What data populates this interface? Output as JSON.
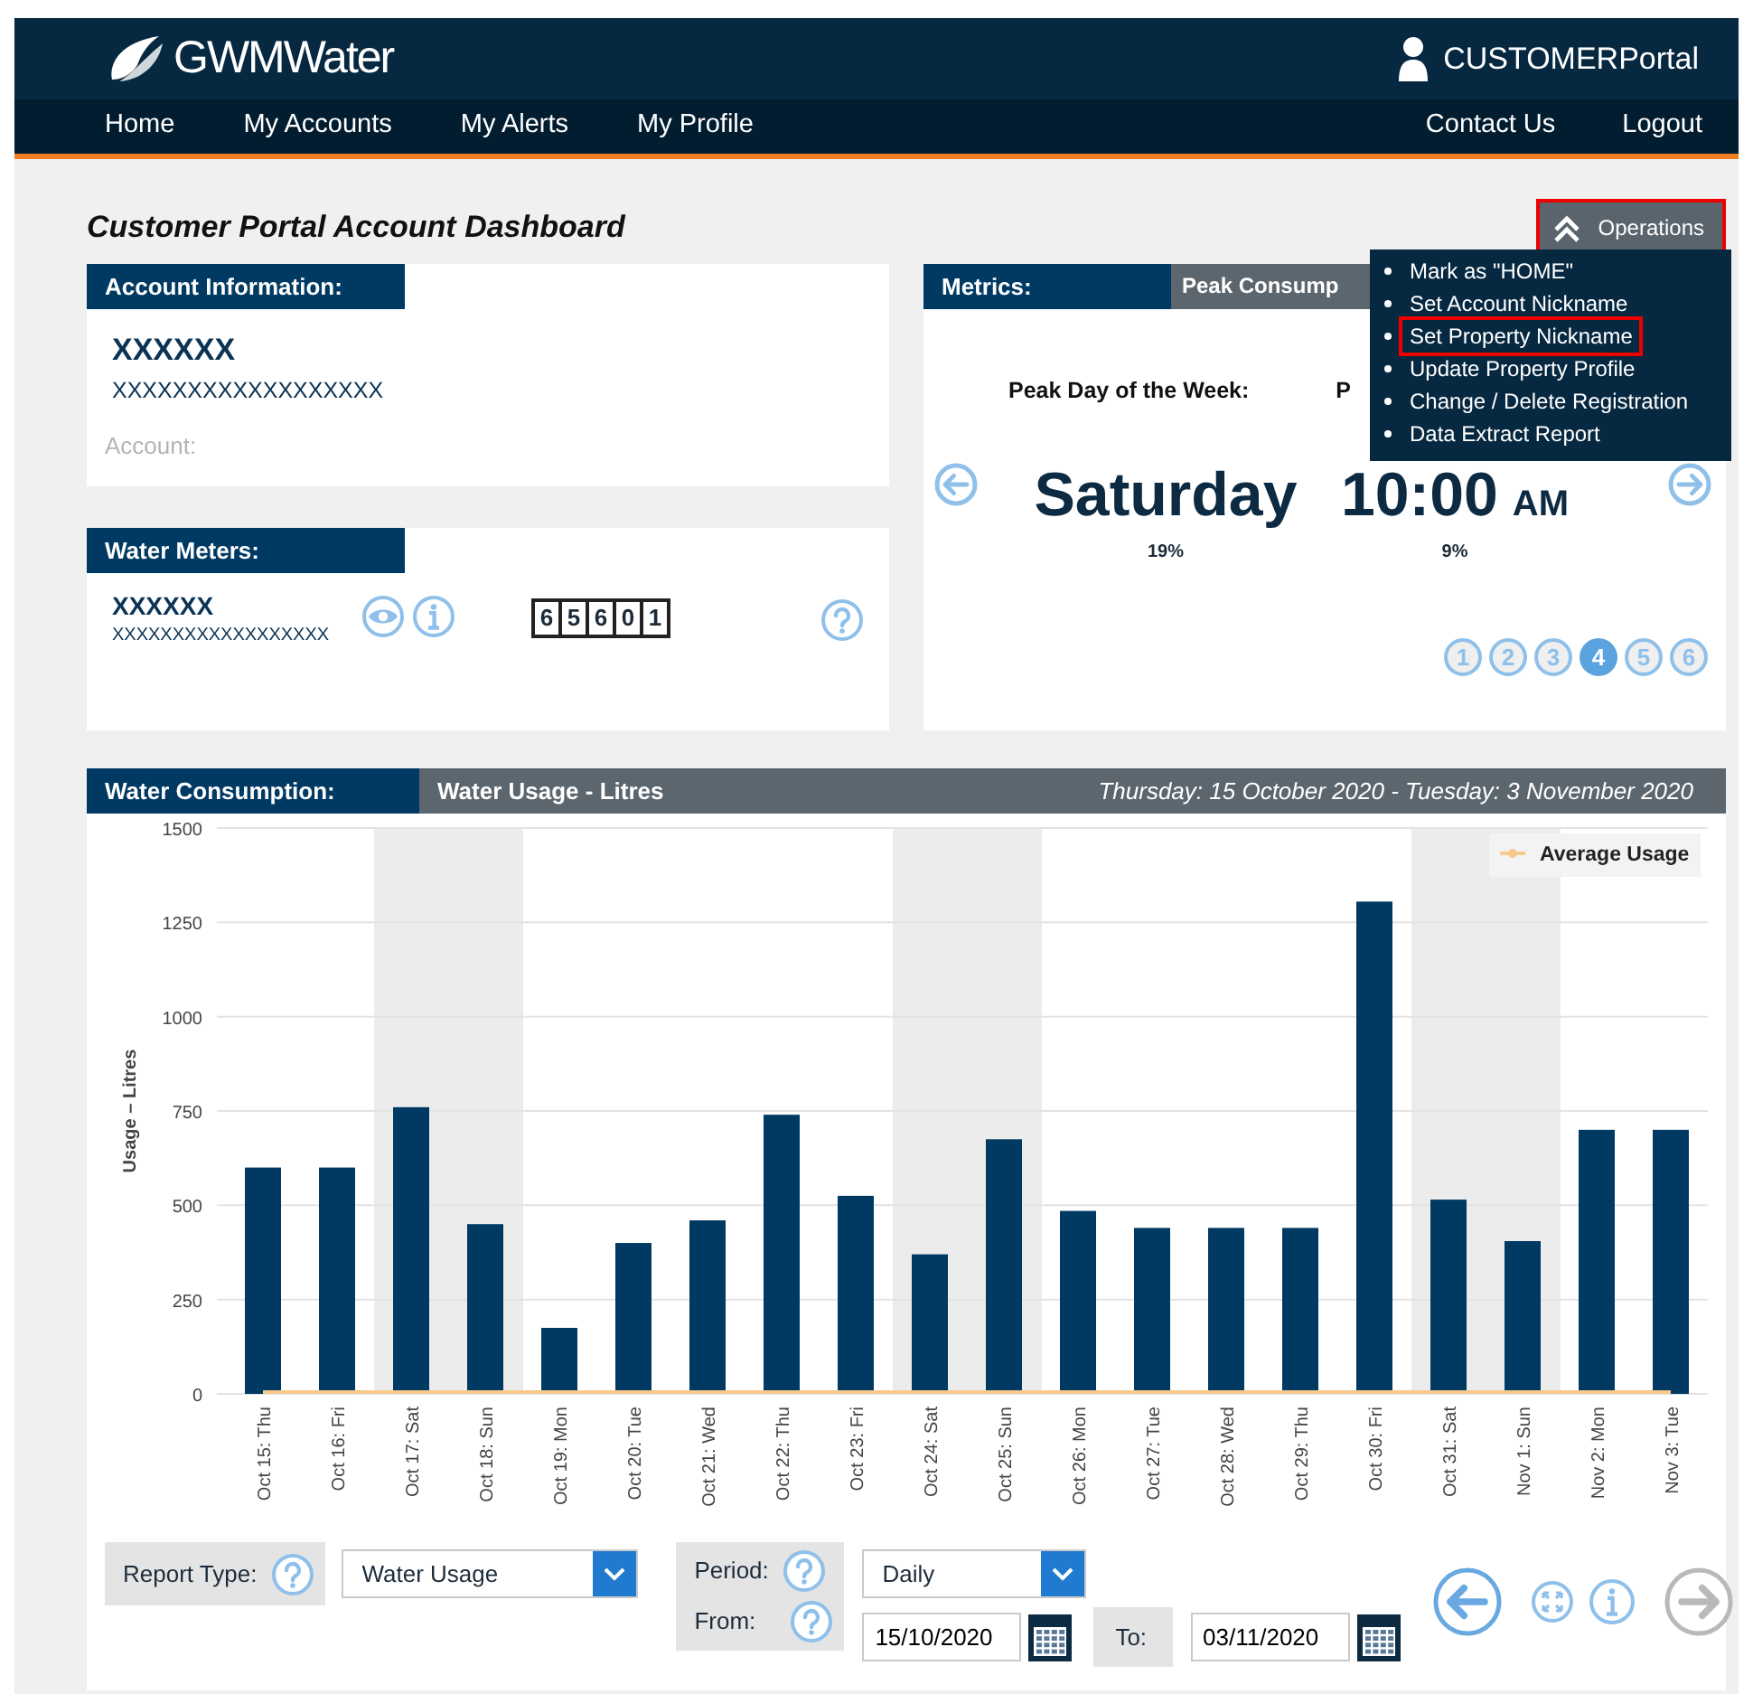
{
  "header": {
    "logo": "**GWM**Water",
    "portal": "**CUSTOMER**Portal"
  },
  "nav": {
    "left": [
      "Home",
      "My Accounts",
      "My Alerts",
      "My Profile"
    ],
    "right": [
      "Contact Us",
      "Logout"
    ]
  },
  "page_title": "Customer Portal Account Dashboard",
  "operations": {
    "label": "Operations",
    "expanded": true,
    "highlighted": true,
    "items": [
      {
        "label": "Mark as \"HOME\"",
        "highlighted": false
      },
      {
        "label": "Set Account Nickname",
        "highlighted": false
      },
      {
        "label": "Set Property Nickname",
        "highlighted": true
      },
      {
        "label": "Update Property Profile",
        "highlighted": false
      },
      {
        "label": "Change / Delete Registration",
        "highlighted": false
      },
      {
        "label": "Data Extract Report",
        "highlighted": false
      }
    ]
  },
  "account_info": {
    "title": "Account Information:",
    "name": "XXXXXX",
    "number": "XXXXXXXXXXXXXXXXXX",
    "account_label": "Account:"
  },
  "water_meters": {
    "title": "Water Meters:",
    "name": "XXXXXX",
    "number": "XXXXXXXXXXXXXXXXXX",
    "reading": [
      "6",
      "5",
      "6",
      "0",
      "1"
    ]
  },
  "metrics": {
    "title": "Metrics:",
    "tab": "Peak Consump",
    "labels": [
      "Peak Day of the Week:",
      "P"
    ],
    "day": "Saturday",
    "day_percent": "19%",
    "time": "10:00",
    "meridiem": "AM",
    "time_percent": "9%",
    "pages": [
      {
        "label": "1",
        "selected": false
      },
      {
        "label": "2",
        "selected": false
      },
      {
        "label": "3",
        "selected": false
      },
      {
        "label": "4",
        "selected": true
      },
      {
        "label": "5",
        "selected": false
      },
      {
        "label": "6",
        "selected": false
      }
    ]
  },
  "consumption": {
    "title": "Water Consumption:",
    "subtitle": "Water Usage - Litres",
    "date_range": "Thursday: 15 October 2020 - Tuesday: 3 November 2020",
    "chart_data": {
      "type": "bar",
      "ylabel": "Usage – Litres",
      "ylim": [
        0,
        1500
      ],
      "yticks": [
        0,
        250,
        500,
        750,
        1000,
        1250,
        1500
      ],
      "categories": [
        "Oct 15: Thu",
        "Oct 16: Fri",
        "Oct 17: Sat",
        "Oct 18: Sun",
        "Oct 19: Mon",
        "Oct 20: Tue",
        "Oct 21: Wed",
        "Oct 22: Thu",
        "Oct 23: Fri",
        "Oct 24: Sat",
        "Oct 25: Sun",
        "Oct 26: Mon",
        "Oct 27: Tue",
        "Oct 28: Wed",
        "Oct 29: Thu",
        "Oct 30: Fri",
        "Oct 31: Sat",
        "Nov 1: Sun",
        "Nov 2: Mon",
        "Nov 3: Tue"
      ],
      "grid": true,
      "series": [
        {
          "color": "#ececec",
          "values": [
            null,
            null,
            1500,
            1500,
            null,
            null,
            null,
            null,
            null,
            1500,
            1500,
            null,
            null,
            null,
            null,
            null,
            1500,
            1500,
            null,
            null
          ]
        },
        {
          "color": "#003a63",
          "values": [
            600,
            600,
            760,
            450,
            175,
            400,
            460,
            740,
            525,
            370,
            675,
            485,
            440,
            440,
            440,
            1305,
            515,
            405,
            700,
            700
          ]
        },
        {
          "name": "Average Usage",
          "color": "#f7c98b",
          "values": [
            0,
            0,
            0,
            0,
            0,
            0,
            0,
            0,
            0,
            0,
            0,
            0,
            0,
            0,
            0,
            0,
            0,
            0,
            0,
            0
          ]
        }
      ]
    }
  },
  "controls": {
    "report_type": {
      "label": "Report Type:",
      "value": "Water Usage"
    },
    "period": {
      "label": "Period:",
      "value": "Daily"
    },
    "from": {
      "label": "From:",
      "value": "15/10/2020"
    },
    "to": {
      "label": "To:",
      "value": "03/11/2020"
    }
  }
}
